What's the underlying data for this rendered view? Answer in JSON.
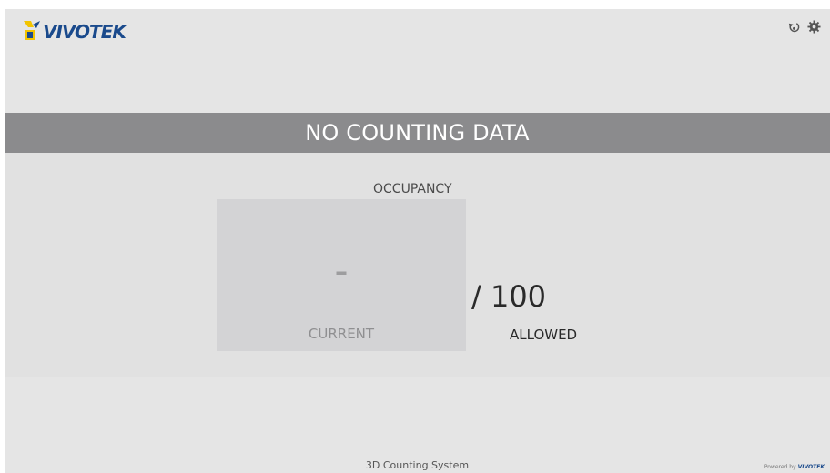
{
  "header": {
    "brand": "VIVOTEK",
    "icons": [
      "logout-icon",
      "gear-icon"
    ]
  },
  "banner": {
    "text": "NO COUNTING DATA"
  },
  "occupancy": {
    "title": "OCCUPANCY",
    "current_value": "–",
    "current_label": "CURRENT",
    "allowed_value": "/ 100",
    "allowed_label": "ALLOWED"
  },
  "footer": {
    "system_name": "3D Counting System",
    "powered_by": "Powered by",
    "powered_brand": "VIVOTEK"
  },
  "colors": {
    "background": "#e5e5e5",
    "banner": "#8b8b8d",
    "current_box": "#d3d3d5",
    "brand_blue": "#1a4a8c",
    "brand_yellow": "#f2c400"
  }
}
